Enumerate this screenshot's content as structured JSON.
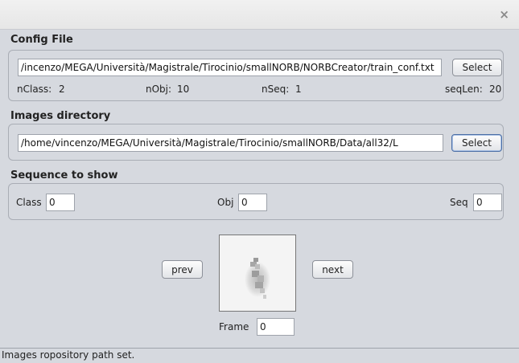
{
  "window": {
    "close_glyph": "×"
  },
  "config": {
    "title": "Config File",
    "path": "/incenzo/MEGA/Università/Magistrale/Tirocinio/smallNORB/NORBCreator/train_conf.txt",
    "select_label": "Select",
    "nclass_label": "nClass:",
    "nclass_value": "2",
    "nobj_label": "nObj:",
    "nobj_value": "10",
    "nseq_label": "nSeq:",
    "nseq_value": "1",
    "seqlen_label": "seqLen:",
    "seqlen_value": "20"
  },
  "images": {
    "title": "Images directory",
    "path": "/home/vincenzo/MEGA/Università/Magistrale/Tirocinio/smallNORB/Data/all32/L",
    "select_label": "Select"
  },
  "sequence": {
    "title": "Sequence to show",
    "class_label": "Class",
    "class_value": "0",
    "obj_label": "Obj",
    "obj_value": "0",
    "seq_label": "Seq",
    "seq_value": "0"
  },
  "viewer": {
    "prev_label": "prev",
    "next_label": "next",
    "frame_label": "Frame",
    "frame_value": "0"
  },
  "status": {
    "text": "Images ropository path set."
  }
}
